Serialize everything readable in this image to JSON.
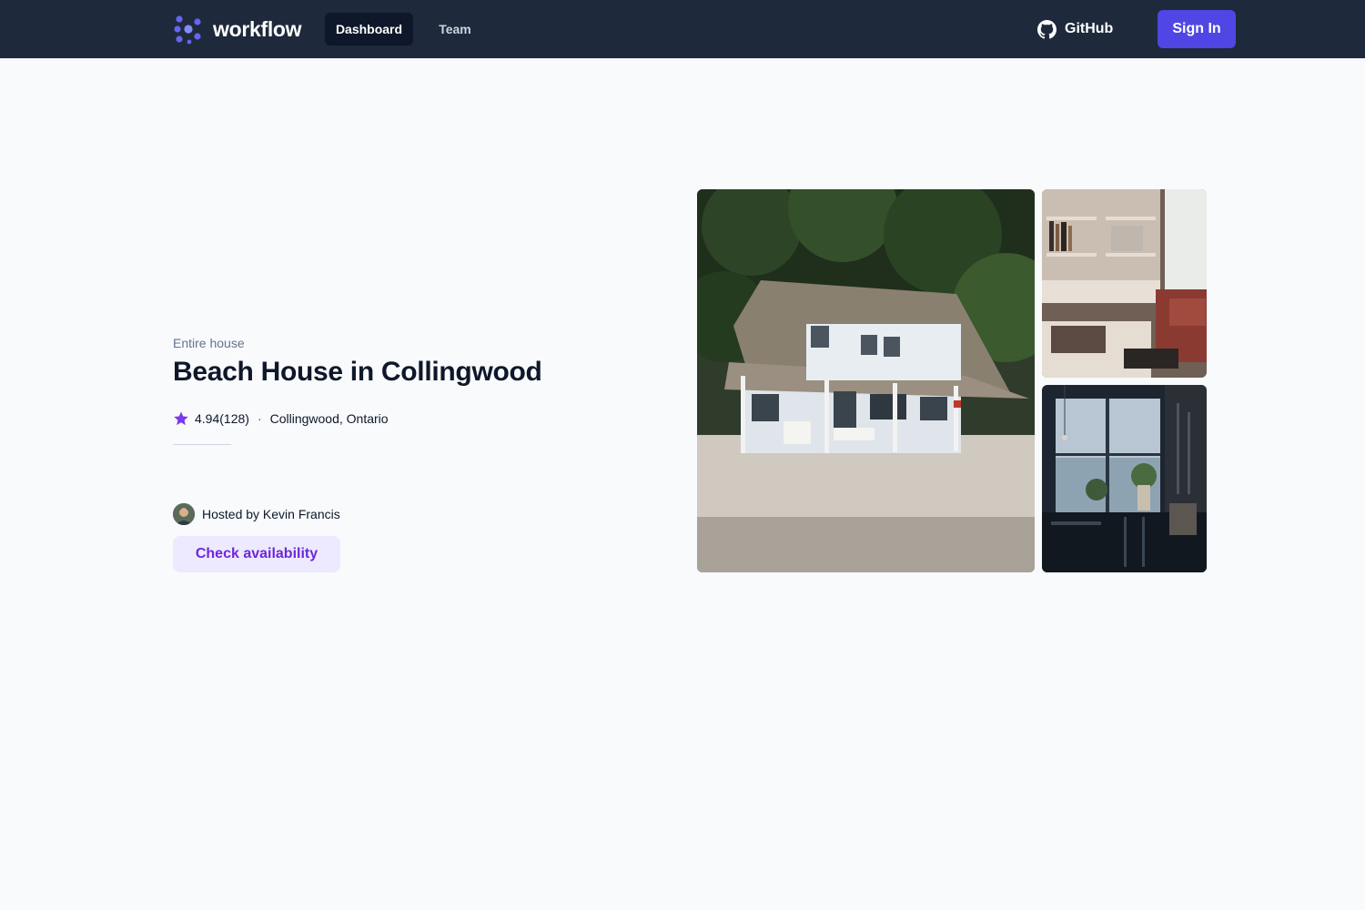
{
  "nav": {
    "brand": "workflow",
    "brand_icon": "workflow-logo-icon",
    "items": [
      {
        "label": "Dashboard",
        "active": true
      },
      {
        "label": "Team",
        "active": false
      }
    ],
    "github_label": "GitHub",
    "github_icon": "github-icon",
    "signin_label": "Sign In"
  },
  "listing": {
    "type": "Entire house",
    "title": "Beach House in Collingwood",
    "rating": "4.94",
    "reviews": "(128)",
    "separator": "·",
    "location": "Collingwood, Ontario",
    "host": "Hosted by Kevin Francis",
    "cta": "Check availability"
  },
  "photos": [
    {
      "description": "beach house exterior"
    },
    {
      "description": "bookshelf interior"
    },
    {
      "description": "window dining interior"
    }
  ],
  "colors": {
    "nav_bg": "#1e293b",
    "accent": "#4f46e5",
    "cta_bg": "#ede9fe",
    "cta_text": "#6d28d9",
    "page_bg": "#f8fafc"
  }
}
